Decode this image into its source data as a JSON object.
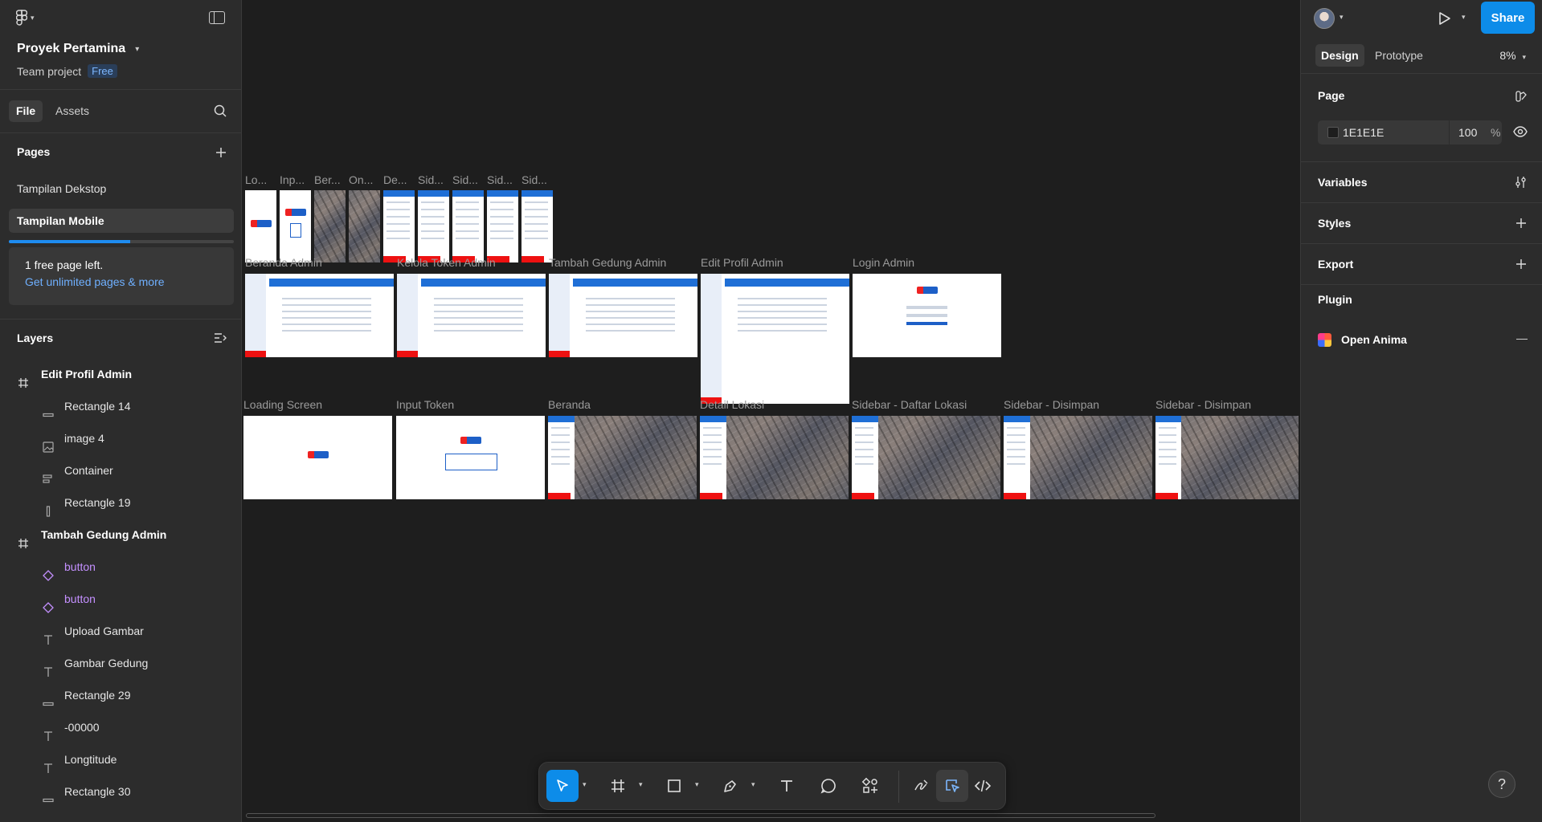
{
  "project": {
    "title": "Proyek Pertamina",
    "team": "Team project",
    "plan_badge": "Free"
  },
  "left_tabs": [
    {
      "label": "File",
      "active": true
    },
    {
      "label": "Assets",
      "active": false
    }
  ],
  "pages": {
    "heading": "Pages",
    "items": [
      {
        "label": "Tampilan Dekstop",
        "active": false
      },
      {
        "label": "Tampilan Mobile",
        "active": true
      }
    ],
    "usage_fraction": 0.54,
    "upsell": {
      "text": "1 free page left.",
      "link": "Get unlimited pages & more"
    }
  },
  "layers": {
    "heading": "Layers",
    "items": [
      {
        "label": "Edit Profil Admin",
        "kind": "frame",
        "icon": "frame-icon"
      },
      {
        "label": "Rectangle 14",
        "kind": "child",
        "icon": "rectangle-icon"
      },
      {
        "label": "image 4",
        "kind": "child",
        "icon": "image-icon"
      },
      {
        "label": "Container",
        "kind": "child",
        "icon": "auto-layout-icon"
      },
      {
        "label": "Rectangle 19",
        "kind": "child",
        "icon": "vertical-rectangle-icon"
      },
      {
        "label": "Tambah Gedung Admin",
        "kind": "frame",
        "icon": "frame-icon"
      },
      {
        "label": "button",
        "kind": "comp",
        "icon": "component-instance-icon"
      },
      {
        "label": "button",
        "kind": "comp",
        "icon": "component-instance-icon"
      },
      {
        "label": "Upload Gambar",
        "kind": "child",
        "icon": "text-icon"
      },
      {
        "label": "Gambar Gedung",
        "kind": "child",
        "icon": "text-icon"
      },
      {
        "label": "Rectangle 29",
        "kind": "child",
        "icon": "rectangle-icon"
      },
      {
        "label": "-00000",
        "kind": "child",
        "icon": "text-icon"
      },
      {
        "label": "Longtitude",
        "kind": "child",
        "icon": "text-icon"
      },
      {
        "label": "Rectangle 30",
        "kind": "child",
        "icon": "rectangle-icon"
      }
    ]
  },
  "canvas": {
    "row1_labels": [
      "Lo...",
      "Inp...",
      "Ber...",
      "On...",
      "De...",
      "Sid...",
      "Sid...",
      "Sid...",
      "Sid..."
    ],
    "row2_labels": [
      "Beranda Admin",
      "Kelola Token Admin",
      "Tambah Gedung Admin",
      "Edit Profil Admin",
      "Login Admin"
    ],
    "row3_labels": [
      "Loading Screen",
      "Input Token",
      "Beranda",
      "Detail Lokasi",
      "Sidebar - Daftar Lokasi",
      "Sidebar - Disimpan",
      "Sidebar - Disimpan"
    ]
  },
  "toolbar": {
    "tools": [
      "move-tool",
      "frame-tool",
      "rectangle-tool",
      "pen-tool",
      "text-tool",
      "comment-tool",
      "actions-tool"
    ],
    "active_tool": "move-tool",
    "modes": [
      "draw-mode",
      "design-mode",
      "dev-mode"
    ],
    "active_mode": "design-mode"
  },
  "right": {
    "share_label": "Share",
    "tabs": [
      {
        "label": "Design",
        "active": true
      },
      {
        "label": "Prototype",
        "active": false
      }
    ],
    "zoom": "8%",
    "page_section": {
      "heading": "Page",
      "color_hex": "1E1E1E",
      "opacity": "100",
      "percent_sign": "%"
    },
    "sections": [
      "Variables",
      "Styles",
      "Export"
    ],
    "plugin": {
      "heading": "Plugin",
      "name": "Open Anima"
    },
    "help": "?"
  },
  "colors": {
    "accent": "#0d8ce9",
    "panel": "#2c2c2c",
    "canvas": "#1e1e1e",
    "component": "#c490ff"
  }
}
